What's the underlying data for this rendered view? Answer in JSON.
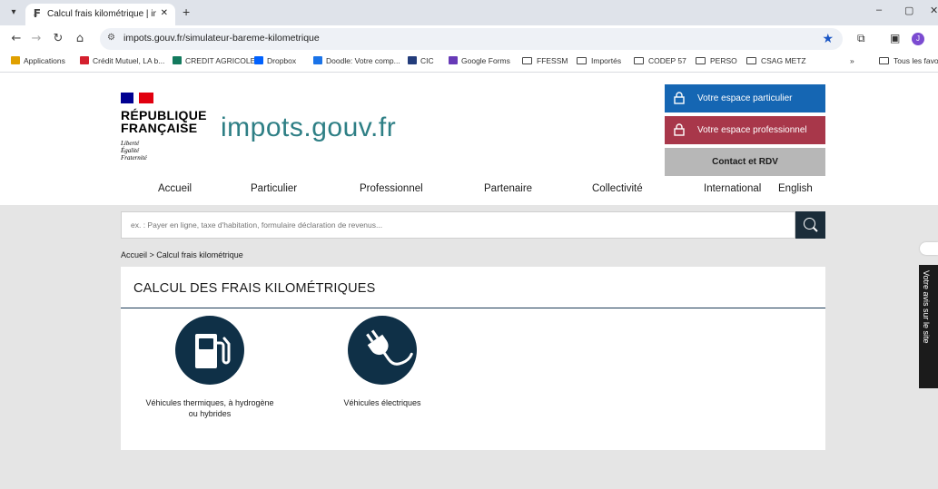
{
  "browser": {
    "tab_title": "Calcul frais kilométrique | impot",
    "tab_favicon": "₣",
    "new_tab": "+",
    "url": "impots.gouv.fr/simulateur-bareme-kilometrique",
    "window": {
      "minimize": "–",
      "maximize": "▢",
      "close": "✕"
    }
  },
  "bookmarks": [
    {
      "label": "Applications",
      "color": "#e0a000"
    },
    {
      "label": "Crédit Mutuel, LA b...",
      "color": "#d4202e"
    },
    {
      "label": "CREDIT AGRICOLE",
      "color": "#137a5e"
    },
    {
      "label": "Dropbox",
      "color": "#0061fe"
    },
    {
      "label": "Doodle: Votre comp...",
      "color": "#1a73e8"
    },
    {
      "label": "CIC",
      "color": "#233c7b"
    },
    {
      "label": "Google Forms",
      "color": "#673ab7"
    },
    {
      "label": "FFESSM",
      "folder": true
    },
    {
      "label": "Importés",
      "folder": true
    },
    {
      "label": "CODEP 57",
      "folder": true
    },
    {
      "label": "PERSO",
      "folder": true
    },
    {
      "label": "CSAG METZ",
      "folder": true
    },
    {
      "label": "»"
    },
    {
      "label": "Tous les favoris",
      "folder": true
    }
  ],
  "logo": {
    "title_line1": "RÉPUBLIQUE",
    "title_line2": "FRANÇAISE",
    "motto": [
      "Liberté",
      "Égalité",
      "Fraternité"
    ],
    "brand": "impots.gouv.fr"
  },
  "account_buttons": {
    "particulier": "Votre espace particulier",
    "professionnel": "Votre espace professionnel",
    "contact": "Contact et RDV"
  },
  "nav": [
    "Accueil",
    "Particulier",
    "Professionnel",
    "Partenaire",
    "Collectivité",
    "International",
    "English"
  ],
  "search": {
    "placeholder": "ex. : Payer en ligne, taxe d'habitation, formulaire déclaration de revenus..."
  },
  "breadcrumb": "Accueil > Calcul frais kilométrique",
  "panel": {
    "title": "CALCUL DES FRAIS KILOMÉTRIQUES",
    "vehicles": [
      {
        "line1": "Véhicules thermiques, à hydrogène",
        "line2": "ou hybrides",
        "icon": "fuel-pump-icon"
      },
      {
        "line1": "Véhicules électriques",
        "line2": "",
        "icon": "electric-plug-icon"
      }
    ]
  },
  "feedback": "Votre avis sur le site",
  "colors": {
    "brand_teal": "#2e7f85",
    "btn_particulier": "#1566b3",
    "btn_professionnel": "#a8374a",
    "btn_contact": "#b7b7b7",
    "icon_navy": "#0f3047"
  }
}
